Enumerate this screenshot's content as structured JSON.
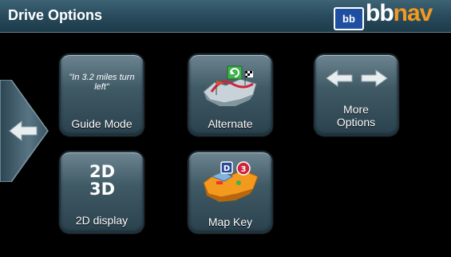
{
  "header": {
    "title": "Drive Options"
  },
  "logo": {
    "box_text": "bb",
    "brand_part1": "bb",
    "brand_part2": "nav"
  },
  "buttons": [
    {
      "label": "Guide Mode",
      "sample_text": "\"In 3.2 miles turn left\"",
      "icon": "speech-text-icon"
    },
    {
      "label": "Alternate",
      "icon": "alternate-route-map-icon"
    },
    {
      "label": "More Options",
      "icon": "double-arrow-icon"
    },
    {
      "label": "2D display",
      "icon": "2d-3d-icon",
      "icon_text_top": "2D",
      "icon_text_bottom": "3D"
    },
    {
      "label": "Map Key",
      "icon": "map-key-icon",
      "badge_d": "D",
      "badge_3": "3"
    }
  ],
  "nav": {
    "back_icon": "left-arrow-icon"
  },
  "colors": {
    "header": "#27495a",
    "accent_orange": "#f39a1e",
    "tile": "#3f5965"
  }
}
